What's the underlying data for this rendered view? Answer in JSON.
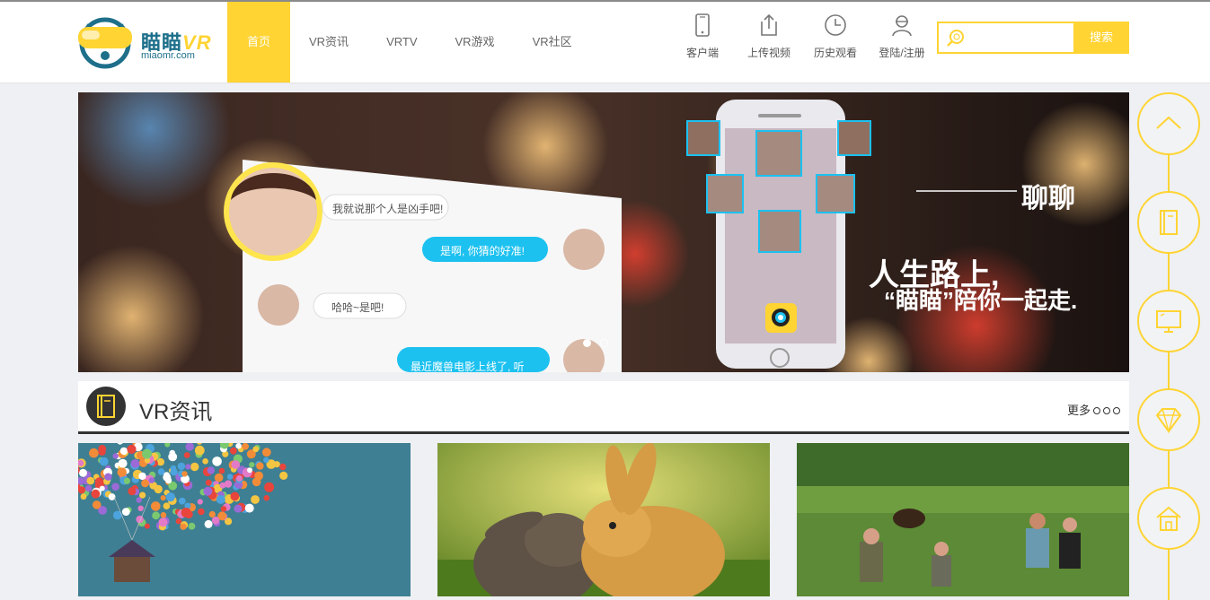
{
  "logo": {
    "name_cn": "瞄瞄",
    "name_vr": "VR",
    "domain": "miaomr.com"
  },
  "nav": [
    {
      "label": "首页",
      "active": true
    },
    {
      "label": "VR资讯",
      "active": false
    },
    {
      "label": "VRTV",
      "active": false
    },
    {
      "label": "VR游戏",
      "active": false
    },
    {
      "label": "VR社区",
      "active": false
    }
  ],
  "tools": [
    {
      "label": "客户端",
      "icon": "phone-icon"
    },
    {
      "label": "上传视频",
      "icon": "upload-icon"
    },
    {
      "label": "历史观看",
      "icon": "clock-icon"
    },
    {
      "label": "登陆/注册",
      "icon": "user-icon"
    }
  ],
  "search": {
    "placeholder": "",
    "button": "搜索"
  },
  "banner": {
    "chat": [
      "我就说那个人是凶手吧!",
      "是啊, 你猜的好准!",
      "哈哈~是吧!",
      "最近魔兽电影上线了, 听"
    ],
    "headline_dash": "———",
    "headline": "聊聊",
    "slogan1": "人生路上,",
    "slogan2": "“瞄瞄”陪你一起走.",
    "slides": 2,
    "active_slide": 0
  },
  "section": {
    "title": "VR资讯",
    "more": "更多"
  },
  "cards": [
    {
      "subject": "balloons-house"
    },
    {
      "subject": "rabbits"
    },
    {
      "subject": "bear-meadow"
    }
  ],
  "sidebar": [
    "arrow-up-icon",
    "book-icon",
    "monitor-icon",
    "diamond-icon",
    "house-icon"
  ],
  "colors": {
    "accent": "#ffd433",
    "brand": "#1d6f8a",
    "dark": "#333333",
    "bubble": "#1cc1f0"
  }
}
